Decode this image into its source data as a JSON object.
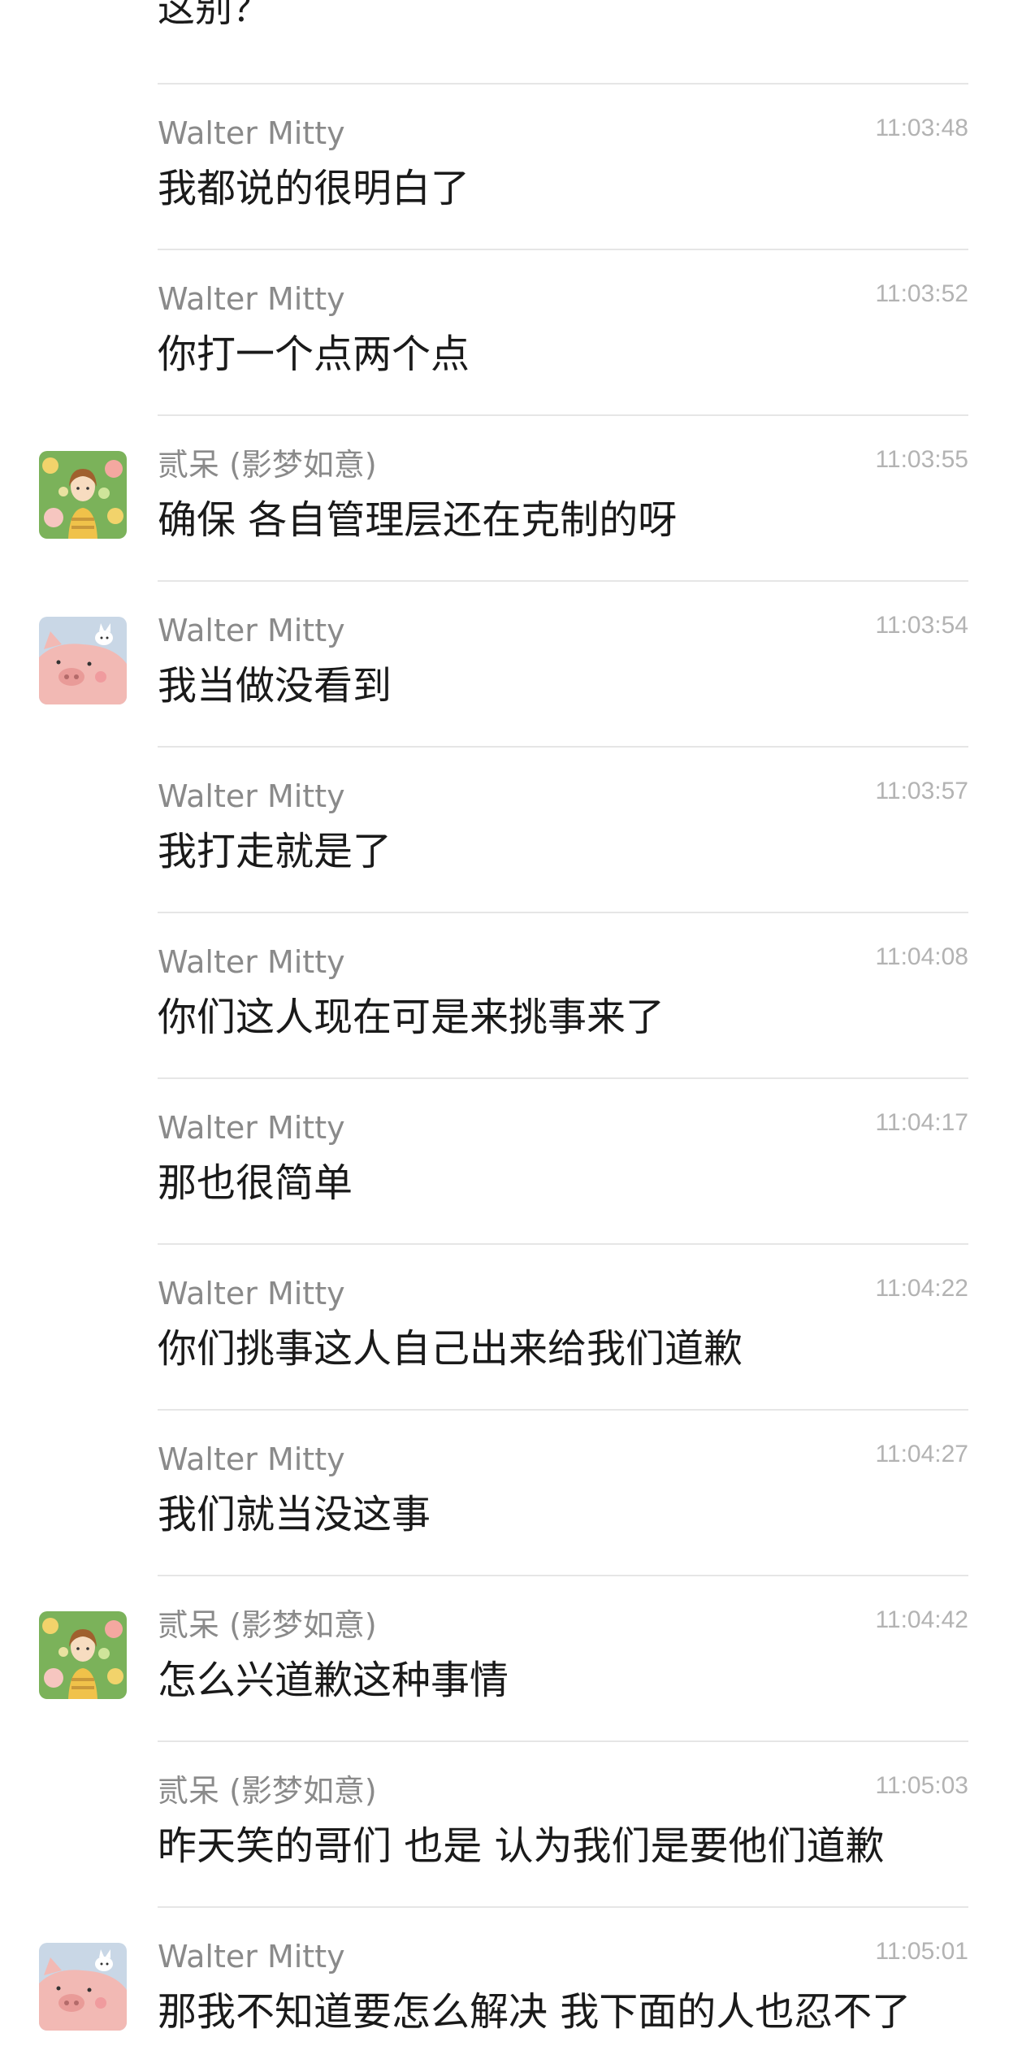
{
  "top_fragment": "这别？",
  "avatars": {
    "girl": "girl-in-flowers-avatar",
    "pig": "pink-pig-avatar"
  },
  "messages": [
    {
      "sender": "Walter Mitty",
      "time": "11:03:48",
      "text": "我都说的很明白了",
      "avatar": ""
    },
    {
      "sender": "Walter Mitty",
      "time": "11:03:52",
      "text": "你打一个点两个点",
      "avatar": ""
    },
    {
      "sender": "贰呆 (影梦如意)",
      "time": "11:03:55",
      "text": "确保 各自管理层还在克制的呀",
      "avatar": "girl"
    },
    {
      "sender": "Walter Mitty",
      "time": "11:03:54",
      "text": "我当做没看到",
      "avatar": "pig"
    },
    {
      "sender": "Walter Mitty",
      "time": "11:03:57",
      "text": "我打走就是了",
      "avatar": ""
    },
    {
      "sender": "Walter Mitty",
      "time": "11:04:08",
      "text": "你们这人现在可是来挑事来了",
      "avatar": ""
    },
    {
      "sender": "Walter Mitty",
      "time": "11:04:17",
      "text": "那也很简单",
      "avatar": ""
    },
    {
      "sender": "Walter Mitty",
      "time": "11:04:22",
      "text": "你们挑事这人自己出来给我们道歉",
      "avatar": ""
    },
    {
      "sender": "Walter Mitty",
      "time": "11:04:27",
      "text": "我们就当没这事",
      "avatar": ""
    },
    {
      "sender": "贰呆 (影梦如意)",
      "time": "11:04:42",
      "text": "怎么兴道歉这种事情",
      "avatar": "girl"
    },
    {
      "sender": "贰呆 (影梦如意)",
      "time": "11:05:03",
      "text": "昨天笑的哥们 也是 认为我们是要他们道歉",
      "avatar": ""
    },
    {
      "sender": "Walter Mitty",
      "time": "11:05:01",
      "text": "那我不知道要怎么解决 我下面的人也忍不了",
      "avatar": "pig"
    }
  ]
}
